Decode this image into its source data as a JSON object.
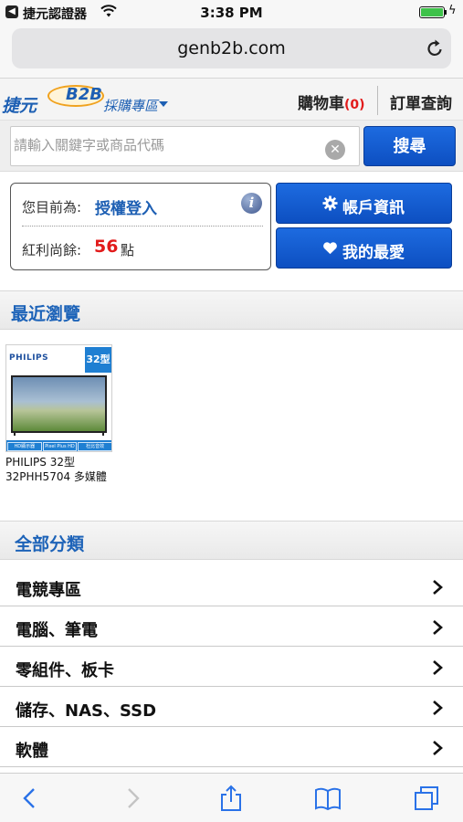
{
  "status_bar": {
    "back_app": "捷元認證器",
    "time": "3:38 PM",
    "battery_level": 1.0
  },
  "browser": {
    "url": "genb2b.com"
  },
  "site_header": {
    "logo_text_left": "捷元",
    "logo_badge": "B2B",
    "logo_text_right": "採購專區",
    "cart_label": "購物車",
    "cart_count": "(0)",
    "order_label": "訂單查詢"
  },
  "search": {
    "placeholder": "請輸入關鍵字或商品代碼",
    "button_label": "搜尋"
  },
  "account": {
    "status_label": "您目前為:",
    "status_value": "授權登入",
    "bonus_label": "紅利尚餘:",
    "bonus_points": "56",
    "bonus_unit": "點",
    "account_button": "帳戶資訊",
    "favorites_button": "我的最愛"
  },
  "recent": {
    "title": "最近瀏覽",
    "items": [
      {
        "brand": "PHILIPS",
        "size_badge": "32型",
        "features": [
          "HD顯示器",
          "Pixel Plus HD",
          "杜比音效"
        ],
        "name": "PHILIPS 32型 32PHH5704 多媒體"
      }
    ]
  },
  "categories": {
    "title": "全部分類",
    "items": [
      {
        "label": "電競專區"
      },
      {
        "label": "電腦、筆電"
      },
      {
        "label": "零組件、板卡"
      },
      {
        "label": "儲存、NAS、SSD"
      },
      {
        "label": "軟體"
      }
    ]
  },
  "icons": {
    "back": "chevron-left-icon",
    "forward": "chevron-right-icon",
    "share": "share-icon",
    "bookmarks": "book-icon",
    "tabs": "tabs-icon"
  },
  "colors": {
    "accent": "#1d63b8",
    "button": "#0d4fc1",
    "points": "#e21b1b"
  }
}
